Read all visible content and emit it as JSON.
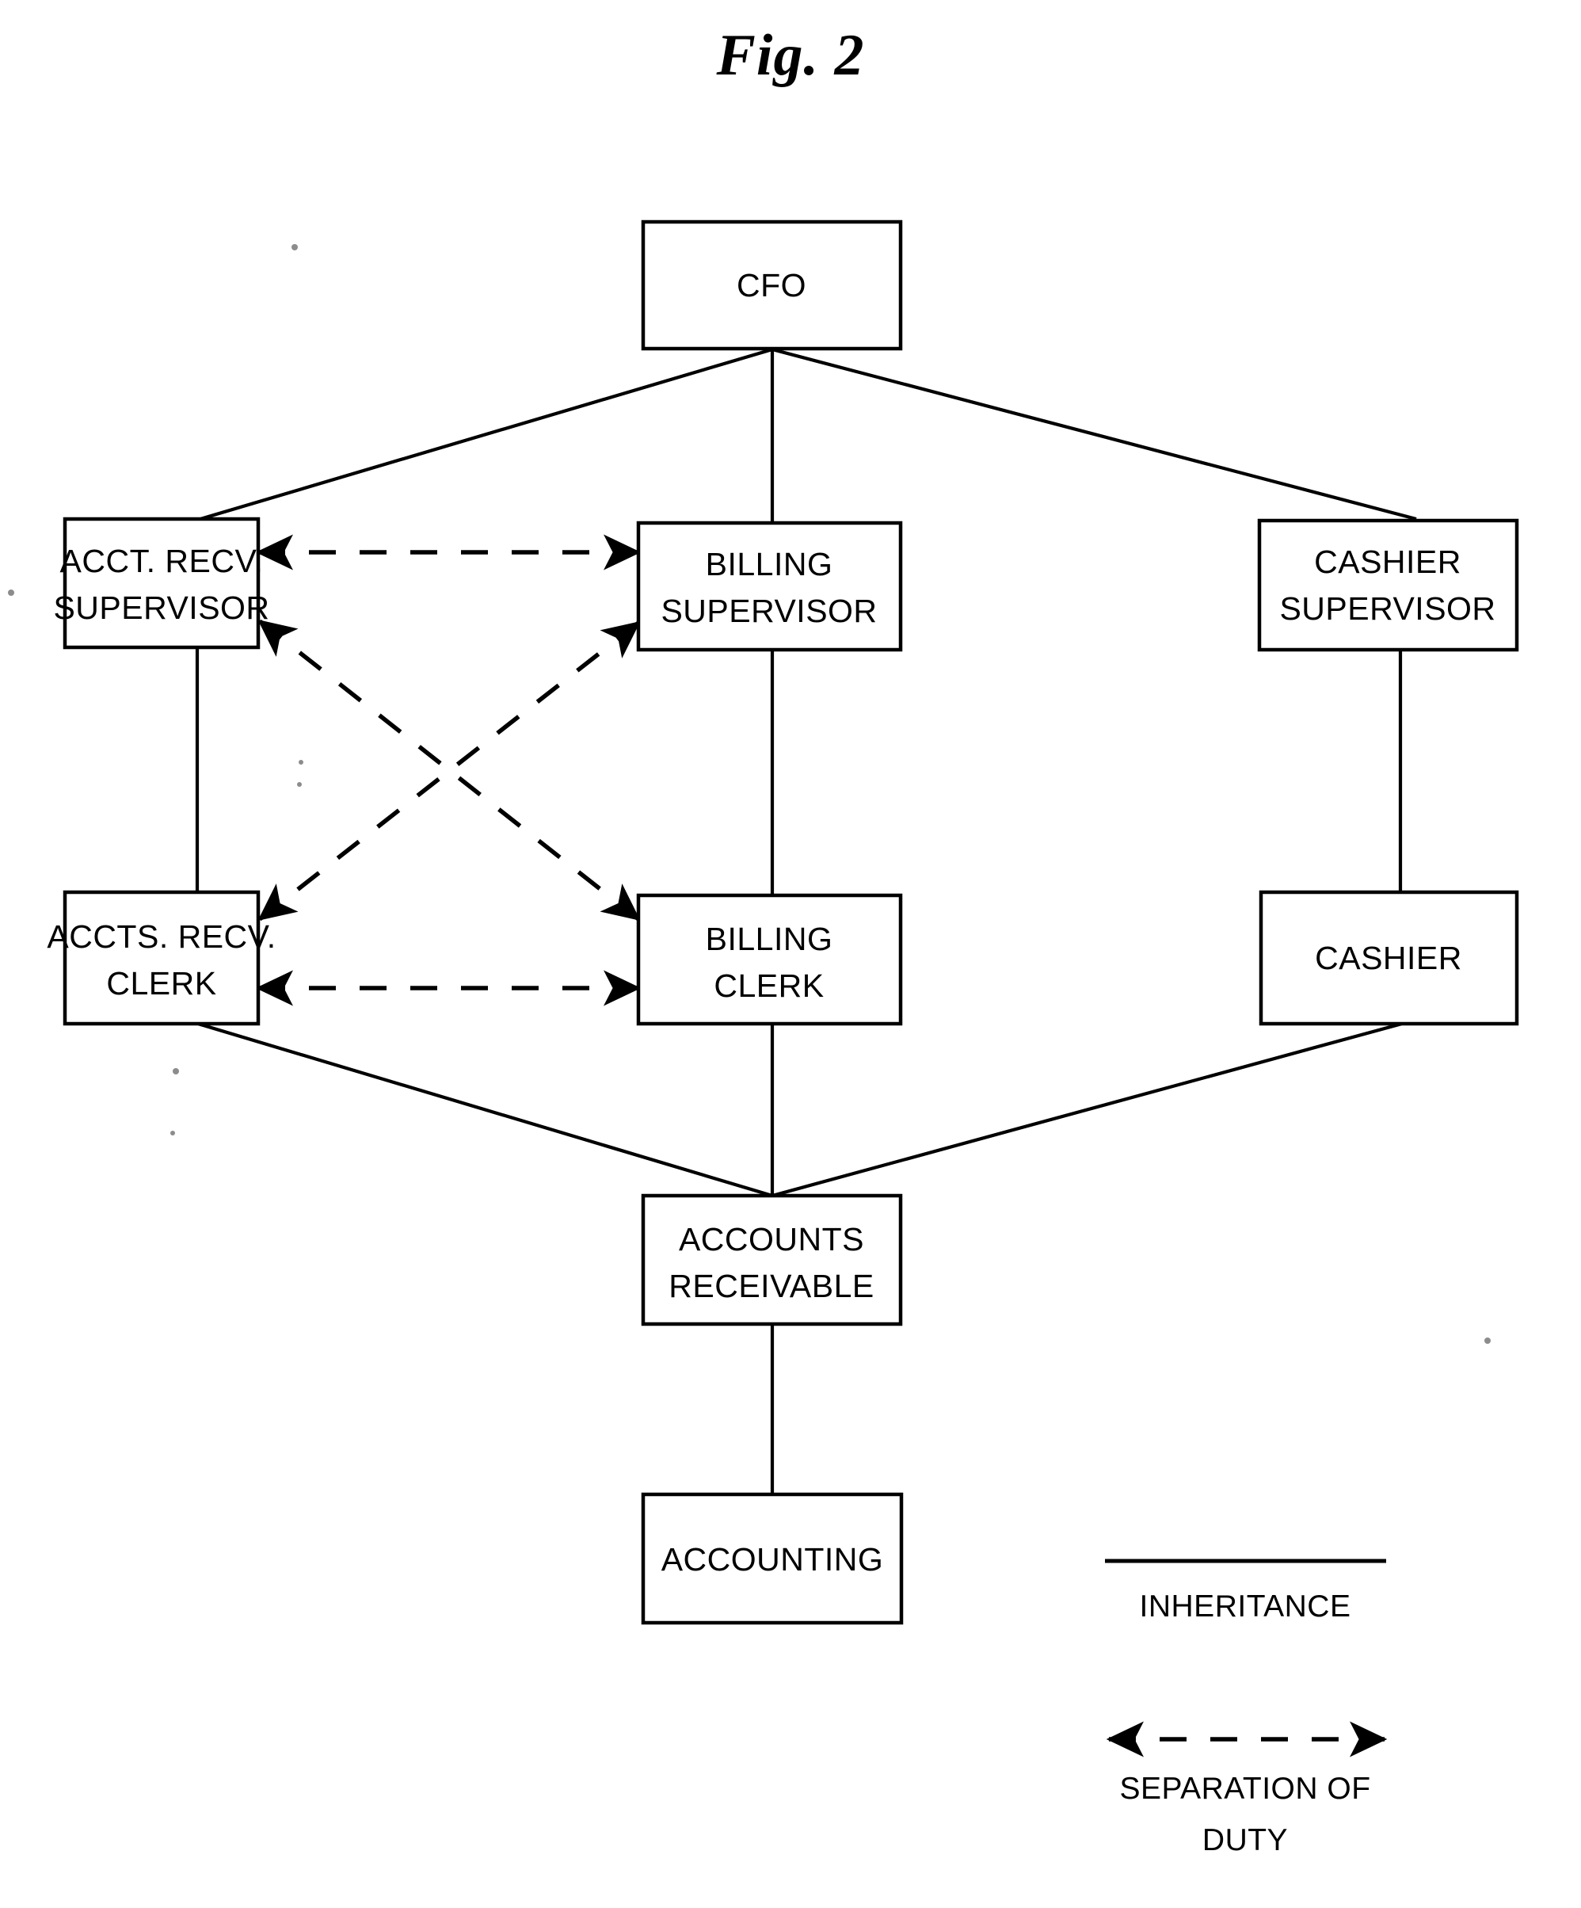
{
  "figure": {
    "title": "Fig. 2",
    "type": "organization-hierarchy-diagram"
  },
  "nodes": [
    {
      "id": "cfo",
      "label_line1": "CFO",
      "label_line2": ""
    },
    {
      "id": "acct-recv-supervisor",
      "label_line1": "ACCT. RECV.",
      "label_line2": "SUPERVISOR"
    },
    {
      "id": "billing-supervisor",
      "label_line1": "BILLING",
      "label_line2": "SUPERVISOR"
    },
    {
      "id": "cashier-supervisor",
      "label_line1": "CASHIER",
      "label_line2": "SUPERVISOR"
    },
    {
      "id": "accts-recv-clerk",
      "label_line1": "ACCTS. RECV.",
      "label_line2": "CLERK"
    },
    {
      "id": "billing-clerk",
      "label_line1": "BILLING",
      "label_line2": "CLERK"
    },
    {
      "id": "cashier",
      "label_line1": "CASHIER",
      "label_line2": ""
    },
    {
      "id": "accounts-receivable",
      "label_line1": "ACCOUNTS",
      "label_line2": "RECEIVABLE"
    },
    {
      "id": "accounting",
      "label_line1": "ACCOUNTING",
      "label_line2": ""
    }
  ],
  "legend": {
    "inheritance_label": "INHERITANCE",
    "separation_label_line1": "SEPARATION OF",
    "separation_label_line2": "DUTY"
  },
  "style": {
    "line_color": "#000000",
    "box_fill": "#ffffff",
    "background": "#ffffff"
  }
}
